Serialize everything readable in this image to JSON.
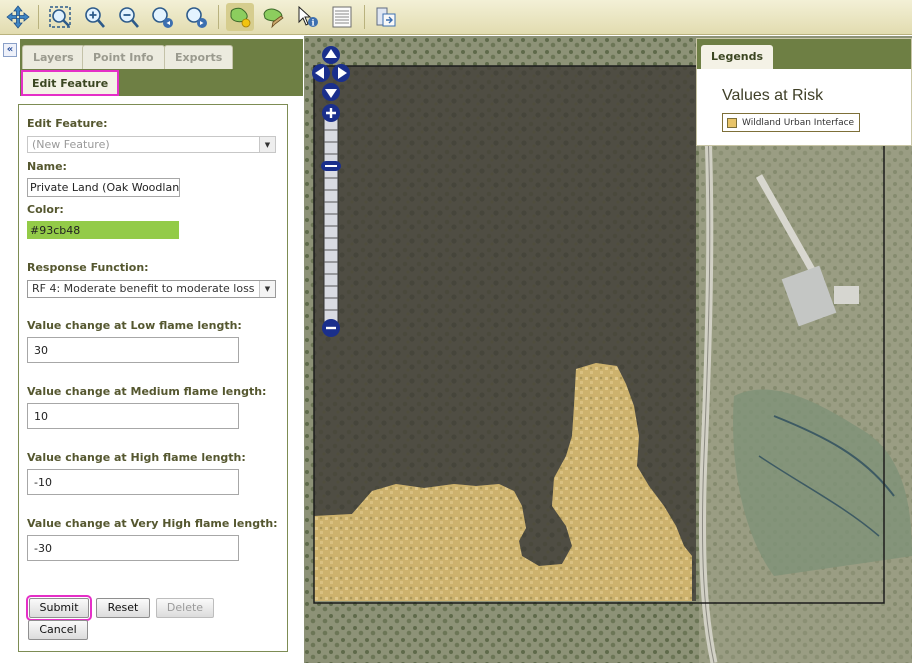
{
  "toolbar": {
    "tools": [
      {
        "name": "pan-tool-icon"
      },
      {
        "name": "zoom-full-extent-icon"
      },
      {
        "name": "zoom-in-icon"
      },
      {
        "name": "zoom-out-icon"
      },
      {
        "name": "zoom-previous-icon"
      },
      {
        "name": "zoom-next-icon"
      },
      {
        "name": "add-feature-icon",
        "active": true
      },
      {
        "name": "edit-feature-icon"
      },
      {
        "name": "identify-icon"
      },
      {
        "name": "attribute-table-icon"
      },
      {
        "name": "export-icon"
      }
    ]
  },
  "panel": {
    "collapse_glyph": "«",
    "tabs": [
      "Layers",
      "Point Info",
      "Exports"
    ],
    "active_tab": "Edit Feature"
  },
  "form": {
    "edit_feature_label": "Edit Feature:",
    "edit_feature_value": "(New Feature)",
    "name_label": "Name:",
    "name_value": "Private Land (Oak Woodland",
    "color_label": "Color:",
    "color_value": "#93cb48",
    "response_label": "Response Function:",
    "response_value": "RF 4: Moderate benefit to moderate loss",
    "low_label": "Value change at Low flame length:",
    "low_value": "30",
    "medium_label": "Value change at Medium flame length:",
    "medium_value": "10",
    "high_label": "Value change at High flame length:",
    "high_value": "-10",
    "veryhigh_label": "Value change at Very High flame length:",
    "veryhigh_value": "-30",
    "submit_label": "Submit",
    "reset_label": "Reset",
    "delete_label": "Delete",
    "cancel_label": "Cancel"
  },
  "legend": {
    "tab": "Legends",
    "title": "Values at Risk",
    "items": [
      {
        "label": "Wildland Urban Interface",
        "color": "#e8c46a"
      }
    ]
  },
  "colors": {
    "panel_green": "#6e7f44",
    "highlight": "#e52fc7",
    "feature_fill": "#93cb48",
    "wui_fill": "#e8c46a",
    "nav_blue": "#1a2f8c"
  }
}
